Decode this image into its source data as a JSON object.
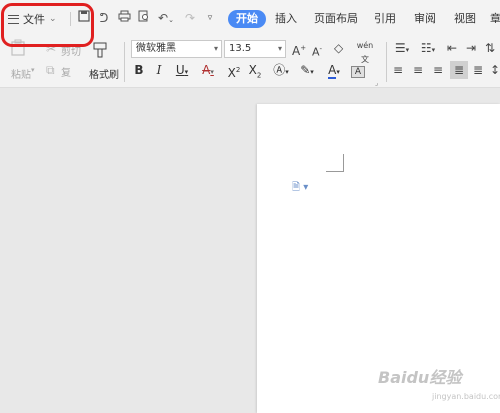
{
  "titlebar": {
    "menu_label": "文件",
    "tabs": [
      {
        "label": "开始",
        "active": true
      },
      {
        "label": "插入"
      },
      {
        "label": "页面布局"
      },
      {
        "label": "引用"
      },
      {
        "label": "审阅"
      },
      {
        "label": "视图"
      },
      {
        "label": "章"
      }
    ]
  },
  "clipboard": {
    "paste_label": "粘贴",
    "cut_label": "剪切",
    "copy_label": "复",
    "format_painter_label": "格式刷"
  },
  "font": {
    "family": "微软雅黑",
    "size": "13.5"
  },
  "phonetic_label": "wén",
  "colors": {
    "accent": "#4a8af4",
    "highlight_annotation": "#e02020",
    "font_color_underline": "#2b5bd7"
  },
  "watermark": {
    "text": "Baidu经验",
    "sub": "jingyan.baidu.com"
  }
}
